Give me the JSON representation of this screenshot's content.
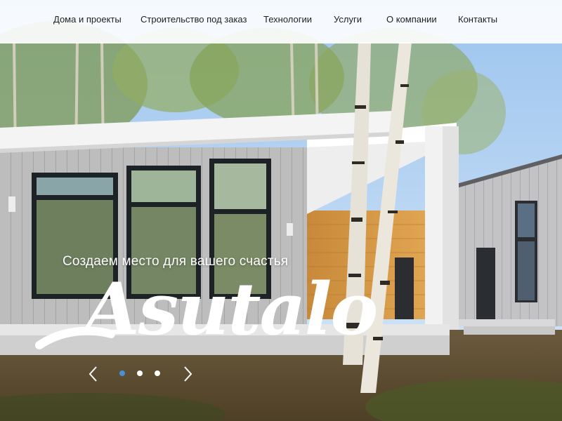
{
  "nav": {
    "items": [
      {
        "label": "Дома и проекты"
      },
      {
        "label": "Строительство под заказ"
      },
      {
        "label": "Технологии"
      },
      {
        "label": "Услуги"
      },
      {
        "label": "О компании"
      },
      {
        "label": "Контакты"
      }
    ]
  },
  "hero": {
    "tagline": "Создаем место для вашего счастья",
    "logo_text": "Asutalo",
    "image": "modern-wooden-house-with-birch-trees"
  },
  "slider": {
    "prev_icon": "chevron-left-icon",
    "next_icon": "chevron-right-icon",
    "slide_count": 3,
    "active_slide": 1
  },
  "colors": {
    "nav_background": "#ffffff",
    "nav_text": "#1f1f1f",
    "active_dot": "#4a90d9",
    "logo": "#ffffff"
  }
}
